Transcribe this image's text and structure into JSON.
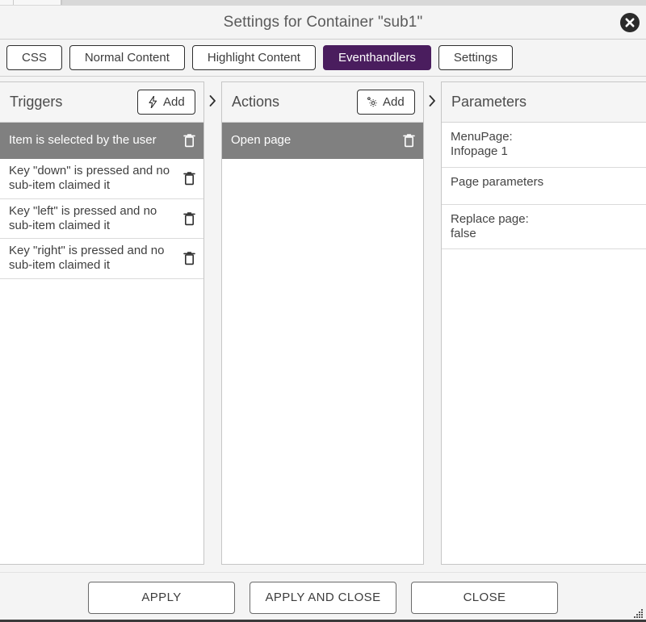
{
  "window": {
    "title": "Settings for Container \"sub1\"",
    "close_icon": "close-circle-icon",
    "resize_grip": "resize-grip-icon",
    "accent_color": "#4a1d5e",
    "selected_row_color": "#808080"
  },
  "tabs": [
    {
      "label": "CSS",
      "active": false
    },
    {
      "label": "Normal Content",
      "active": false
    },
    {
      "label": "Highlight Content",
      "active": false
    },
    {
      "label": "Eventhandlers",
      "active": true
    },
    {
      "label": "Settings",
      "active": false
    }
  ],
  "panels": {
    "triggers": {
      "title": "Triggers",
      "add_label": "Add",
      "add_icon": "lightning-bolt-icon",
      "items": [
        {
          "label": "Item is selected by the user",
          "selected": true,
          "delete_icon": "trash-icon"
        },
        {
          "label": "Key \"down\" is pressed and no sub-item claimed it",
          "selected": false,
          "delete_icon": "trash-icon"
        },
        {
          "label": "Key \"left\" is pressed and no sub-item claimed it",
          "selected": false,
          "delete_icon": "trash-icon"
        },
        {
          "label": "Key \"right\" is pressed and no sub-item claimed it",
          "selected": false,
          "delete_icon": "trash-icon"
        }
      ]
    },
    "actions": {
      "title": "Actions",
      "add_label": "Add",
      "add_icon": "gear-icon",
      "items": [
        {
          "label": "Open page",
          "selected": true,
          "delete_icon": "trash-icon"
        }
      ]
    },
    "parameters": {
      "title": "Parameters",
      "items": [
        {
          "name": "MenuPage:",
          "value": "Infopage 1"
        },
        {
          "name": "Page parameters",
          "value": ""
        },
        {
          "name": "Replace page:",
          "value": "false"
        }
      ]
    }
  },
  "separators": {
    "chevron_icon": "chevron-right-icon"
  },
  "footer": {
    "apply_label": "APPLY",
    "apply_and_close_label": "APPLY AND CLOSE",
    "close_label": "CLOSE"
  }
}
